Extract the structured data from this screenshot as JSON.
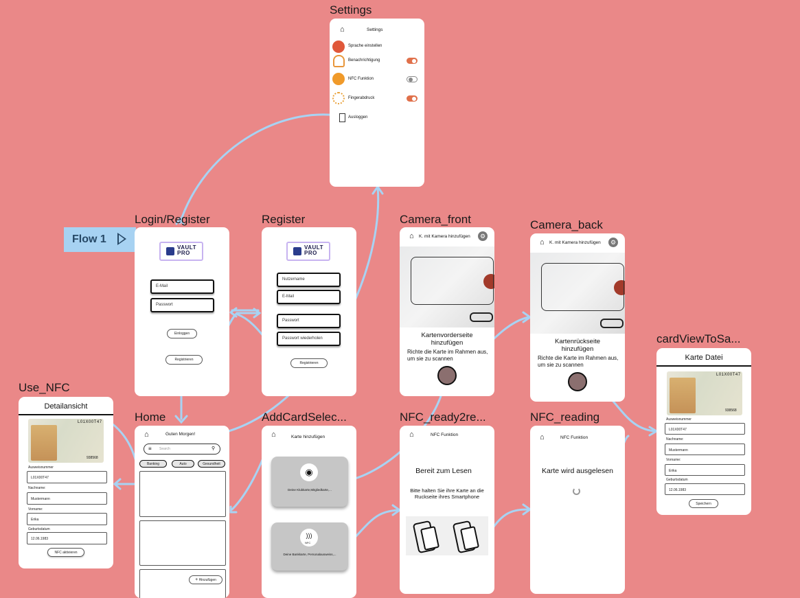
{
  "flow_label": "Flow 1",
  "frames": {
    "settings": "Settings",
    "login": "Login/Register",
    "register": "Register",
    "camera_front": "Camera_front",
    "camera_back": "Camera_back",
    "card_view": "cardViewToSa...",
    "use_nfc": "Use_NFC",
    "home": "Home",
    "add_card": "AddCardSelec...",
    "nfc_ready": "NFC_ready2re...",
    "nfc_reading": "NFC_reading"
  },
  "settings": {
    "title": "Settings",
    "items": [
      "Sprache einstellen",
      "Benachrichtigung",
      "NFC Funktion",
      "Fingerabdruck",
      "Ausloggen"
    ],
    "toggles": [
      true,
      false,
      true
    ]
  },
  "logo": {
    "line1": "VAULT",
    "line2": "PRO"
  },
  "login": {
    "email": "E-Mail",
    "password": "Passwort",
    "login_btn": "Einloggen",
    "register_btn": "Registrieren"
  },
  "register": {
    "username": "Nutzername",
    "email": "E-Mail",
    "password": "Passwort",
    "password_repeat": "Passwort wiederholen",
    "register_btn": "Registrieren"
  },
  "camera_front": {
    "header": "K. mit Kamera hinzufügen",
    "title": "Kartenvorderseite hinzufügen",
    "text": "Richte die Karte im Rahmen aus, um sie zu scannen"
  },
  "camera_back": {
    "header": "K. mit Kamera hinzufügen",
    "title": "Kartenrückseite hinzufügen",
    "text": "Richte die Karte im Rahmen aus, um sie zu scannen"
  },
  "card_view": {
    "header": "Karte Datei",
    "fields": [
      {
        "label": "Ausweisnummer",
        "value": "L01X00T47"
      },
      {
        "label": "Nachname:",
        "value": "Mustermann"
      },
      {
        "label": "Vorname:",
        "value": "Erika"
      },
      {
        "label": "Geburtsdatum",
        "value": "12.06.1983"
      }
    ],
    "save_btn": "Speichern",
    "id_number": "L01X00T47",
    "id_code": "938568"
  },
  "use_nfc": {
    "header": "Detailansicht",
    "fields": [
      {
        "label": "Ausweisnummer",
        "value": "L01X00T47"
      },
      {
        "label": "Nachname:",
        "value": "Mustermann"
      },
      {
        "label": "Vorname:",
        "value": "Erika"
      },
      {
        "label": "Geburtsdatum",
        "value": "12.06.1983"
      }
    ],
    "nfc_btn": "NFC aktivieren",
    "id_number": "L01X00T47",
    "id_code": "938568"
  },
  "home": {
    "greeting": "Guten Morgen!",
    "search_placeholder": "Search",
    "chips": [
      "Banking",
      "Auto",
      "Gesundheit"
    ],
    "add_btn": "Hinzufügen",
    "add_icon": "+"
  },
  "add_card": {
    "title": "Karte hinzufügen",
    "option1": "Deine Klubkarte,Mitgliedkarte,...",
    "option2": "Deine Bankkarte, Personalausweiss,...",
    "nfc_label": "NFC"
  },
  "nfc_ready": {
    "header": "NFC Funktion",
    "title": "Bereit zum Lesen",
    "text": "Bitte halten Sie ihre Karte an die Ruckseite ihres Smartphone"
  },
  "nfc_reading": {
    "header": "NFC Funktion",
    "title": "Karte wird ausgelesen"
  },
  "colors": {
    "canvas": "#ea8888",
    "accent": "#e0704a",
    "connector": "#a7d2f2",
    "flow_tag": "#a7d2f2"
  }
}
